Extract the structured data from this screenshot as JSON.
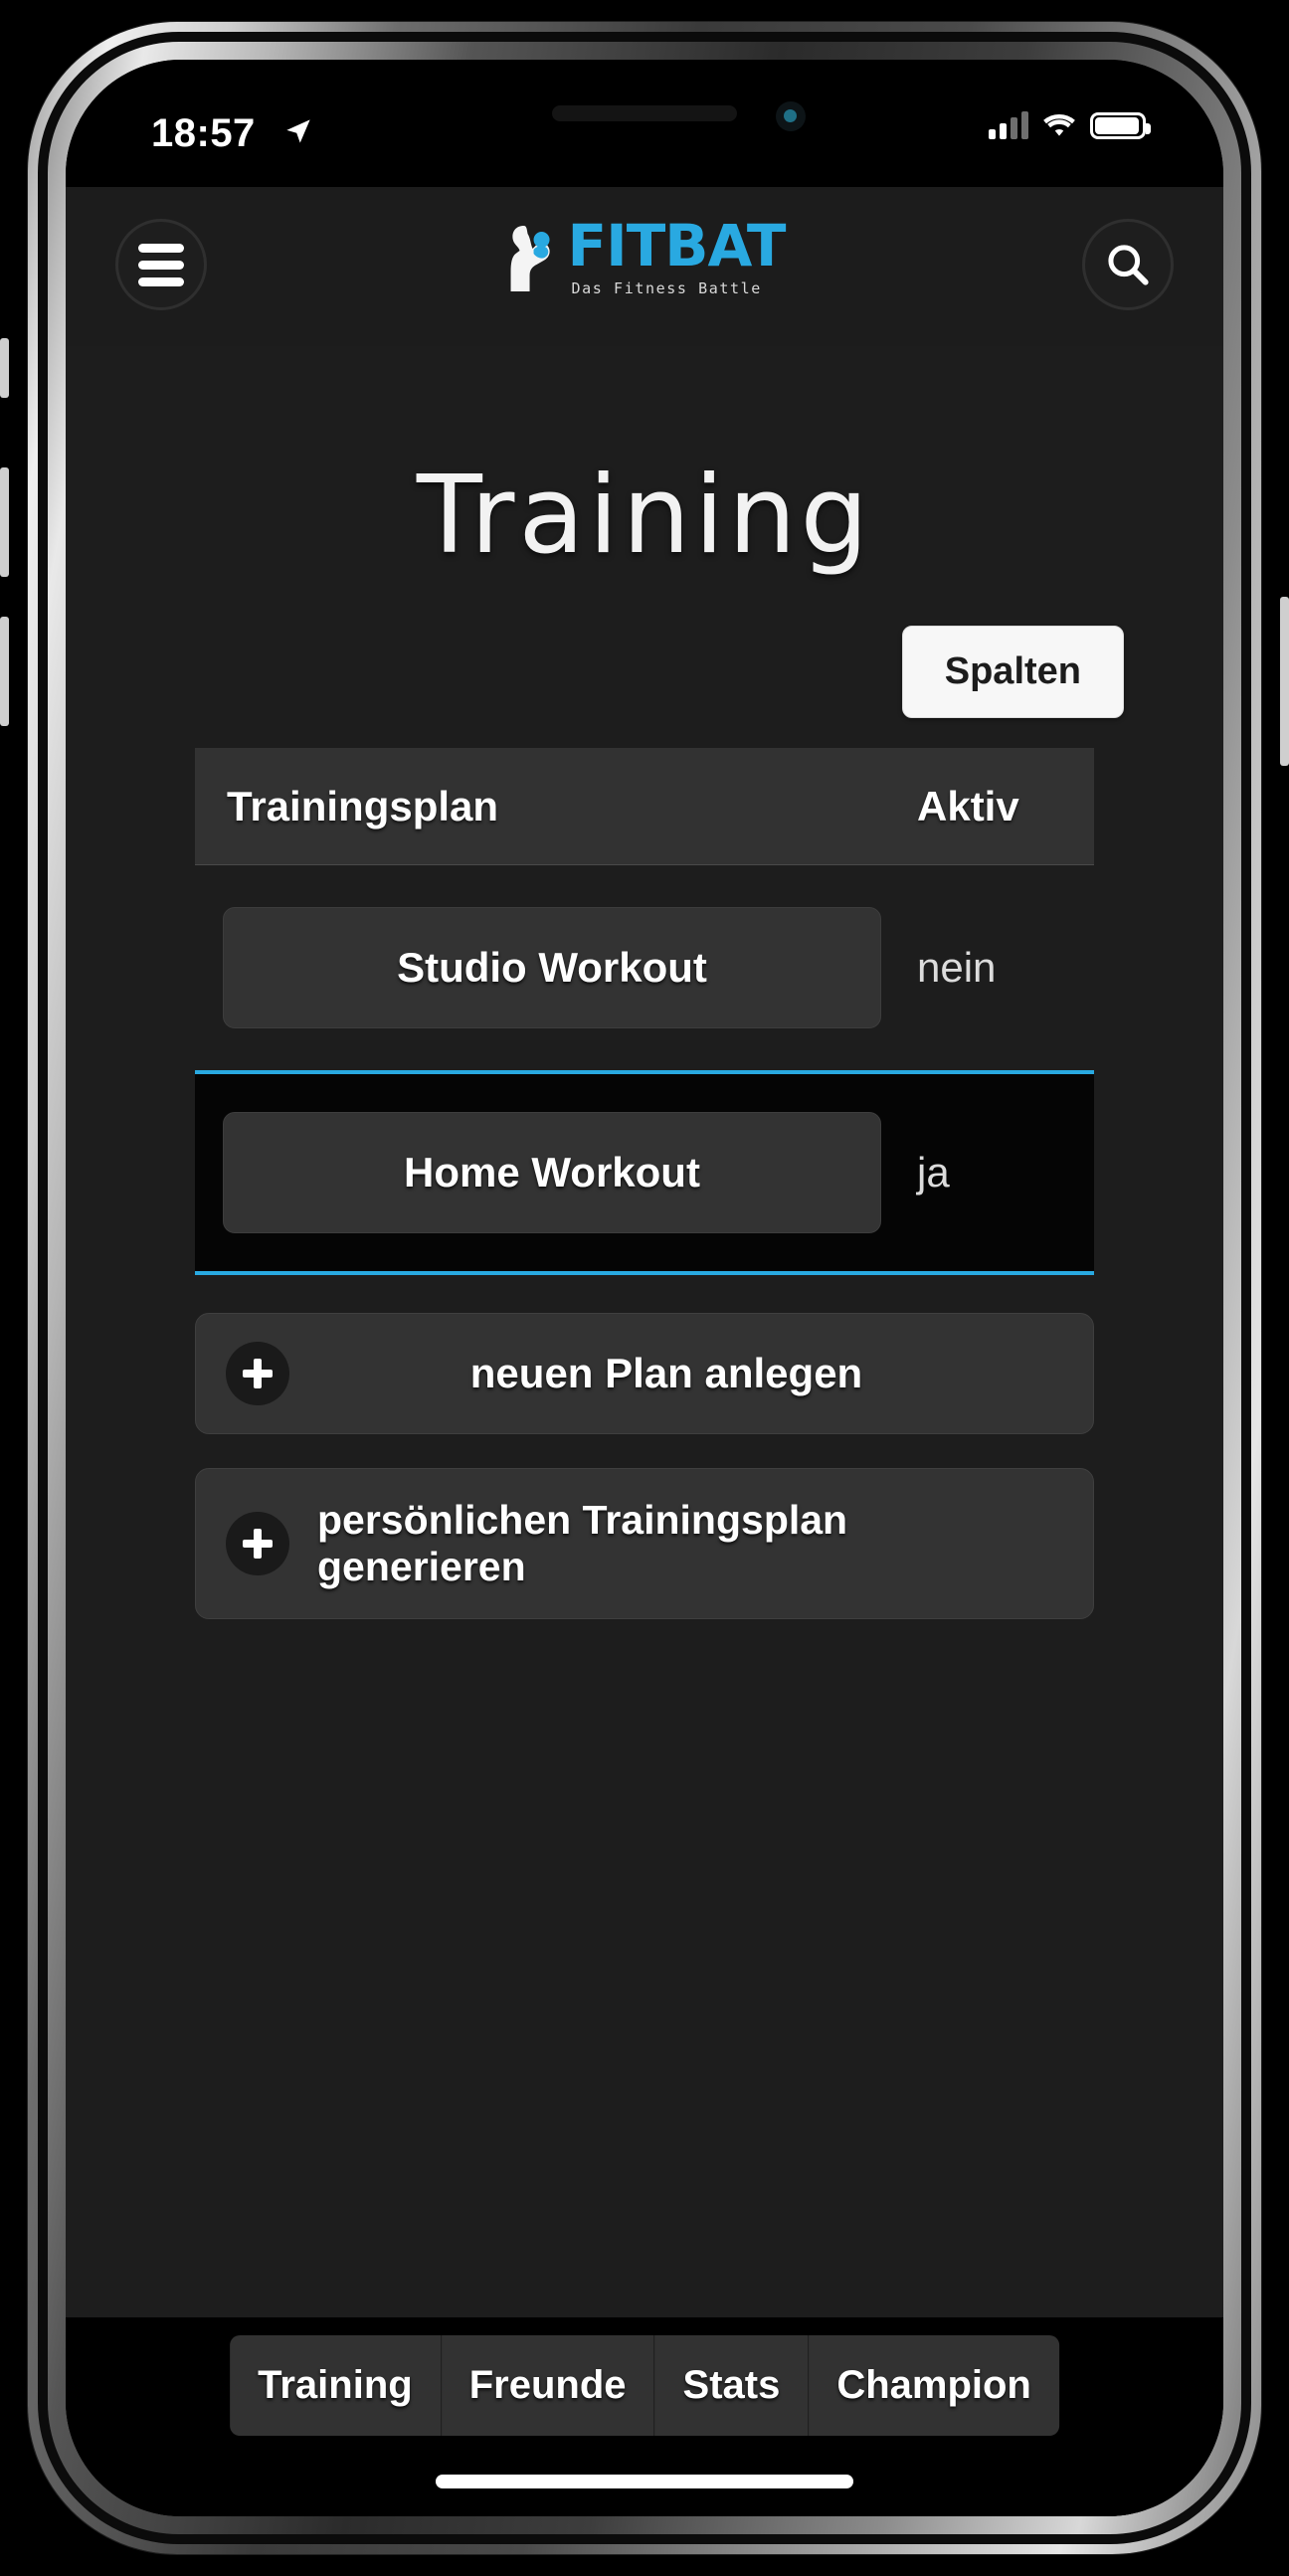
{
  "status_bar": {
    "time": "18:57",
    "location_icon": "location-arrow-icon",
    "signal_icon": "cellular-signal-icon",
    "wifi_icon": "wifi-icon",
    "battery_icon": "battery-full-icon"
  },
  "header": {
    "menu_icon": "hamburger-menu-icon",
    "search_icon": "search-icon",
    "logo_mark": "boxer-silhouette-icon",
    "logo_part1": "FIT",
    "logo_part2": "BAT",
    "logo_tagline": "Das Fitness Battle",
    "brand_color": "#29a9e1"
  },
  "main": {
    "page_title": "Training",
    "columns_button": "Spalten",
    "table": {
      "headers": [
        "Trainingsplan",
        "Aktiv"
      ],
      "rows": [
        {
          "plan": "Studio Workout",
          "aktiv": "nein",
          "highlighted": false
        },
        {
          "plan": "Home Workout",
          "aktiv": "ja",
          "highlighted": true
        }
      ]
    },
    "actions": [
      {
        "icon": "plus-icon",
        "label": "neuen Plan anlegen"
      },
      {
        "icon": "plus-icon",
        "label": "persönlichen Trainingsplan generieren"
      }
    ]
  },
  "tabbar": {
    "tabs": [
      "Training",
      "Freunde",
      "Stats",
      "Champion"
    ]
  }
}
